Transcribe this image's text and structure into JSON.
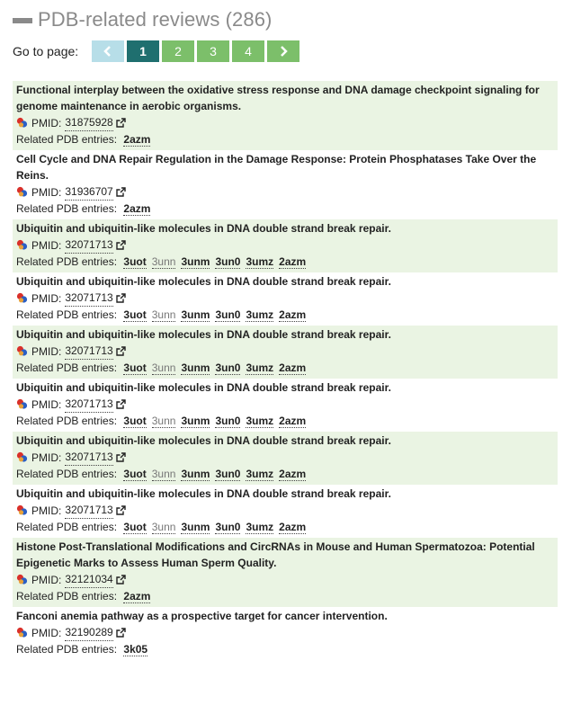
{
  "header": {
    "title": "PDB-related reviews (286)"
  },
  "pager": {
    "label": "Go to page:",
    "pages": [
      "1",
      "2",
      "3",
      "4"
    ],
    "active": "1"
  },
  "labels": {
    "pmid": "PMID:",
    "related": "Related PDB entries:"
  },
  "colors": {
    "shade": "#eaf4e3",
    "pager_green": "#7cbf6a",
    "pager_active": "#1f6f6f",
    "pager_prev": "#b7dee8"
  },
  "entries": [
    {
      "title": "Functional interplay between the oxidative stress response and DNA damage checkpoint signaling for genome maintenance in aerobic organisms.",
      "pmid": "31875928",
      "pdb": [
        "2azm"
      ]
    },
    {
      "title": "Cell Cycle and DNA Repair Regulation in the Damage Response: Protein Phosphatases Take Over the Reins.",
      "pmid": "31936707",
      "pdb": [
        "2azm"
      ]
    },
    {
      "title": "Ubiquitin and ubiquitin-like molecules in DNA double strand break repair.",
      "pmid": "32071713",
      "pdb": [
        "3uot",
        "3unn",
        "3unm",
        "3un0",
        "3umz",
        "2azm"
      ]
    },
    {
      "title": "Ubiquitin and ubiquitin-like molecules in DNA double strand break repair.",
      "pmid": "32071713",
      "pdb": [
        "3uot",
        "3unn",
        "3unm",
        "3un0",
        "3umz",
        "2azm"
      ]
    },
    {
      "title": "Ubiquitin and ubiquitin-like molecules in DNA double strand break repair.",
      "pmid": "32071713",
      "pdb": [
        "3uot",
        "3unn",
        "3unm",
        "3un0",
        "3umz",
        "2azm"
      ]
    },
    {
      "title": "Ubiquitin and ubiquitin-like molecules in DNA double strand break repair.",
      "pmid": "32071713",
      "pdb": [
        "3uot",
        "3unn",
        "3unm",
        "3un0",
        "3umz",
        "2azm"
      ]
    },
    {
      "title": "Ubiquitin and ubiquitin-like molecules in DNA double strand break repair.",
      "pmid": "32071713",
      "pdb": [
        "3uot",
        "3unn",
        "3unm",
        "3un0",
        "3umz",
        "2azm"
      ]
    },
    {
      "title": "Ubiquitin and ubiquitin-like molecules in DNA double strand break repair.",
      "pmid": "32071713",
      "pdb": [
        "3uot",
        "3unn",
        "3unm",
        "3un0",
        "3umz",
        "2azm"
      ]
    },
    {
      "title": "Histone Post-Translational Modifications and CircRNAs in Mouse and Human Spermatozoa: Potential Epigenetic Marks to Assess Human Sperm Quality.",
      "pmid": "32121034",
      "pdb": [
        "2azm"
      ]
    },
    {
      "title": "Fanconi anemia pathway as a prospective target for cancer intervention.",
      "pmid": "32190289",
      "pdb": [
        "3k05"
      ]
    }
  ]
}
